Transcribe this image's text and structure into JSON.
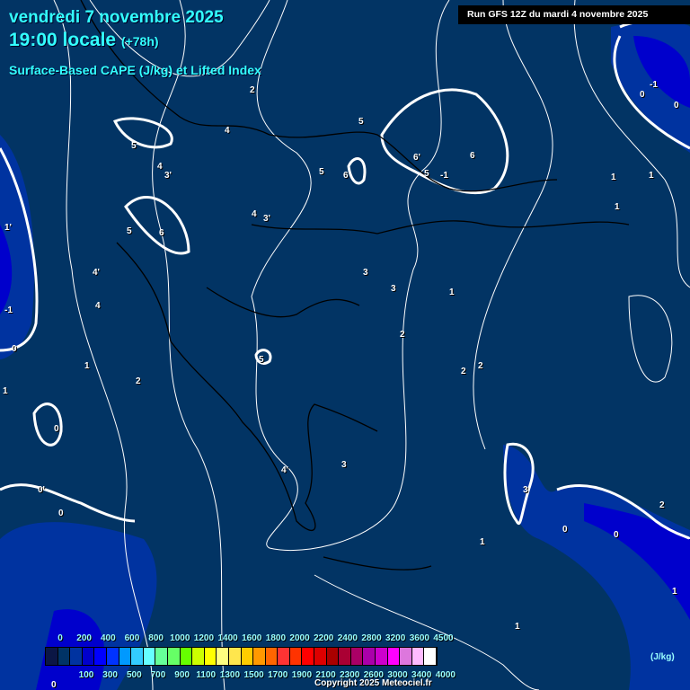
{
  "header": {
    "date": "vendredi 7 novembre 2025",
    "time": "19:00 locale",
    "offset": "(+78h)",
    "parameter": "Surface-Based CAPE (J/kg) et Lifted Index",
    "run": "Run GFS 12Z du mardi 4 novembre 2025"
  },
  "legend": {
    "colors": [
      "#0b1645",
      "#003366",
      "#0033a0",
      "#0000cc",
      "#0000ff",
      "#0033ff",
      "#0099ff",
      "#33ccff",
      "#66ffff",
      "#66ff99",
      "#66ff66",
      "#66ff00",
      "#ccff00",
      "#ffff00",
      "#ffff80",
      "#ffe64d",
      "#ffcc00",
      "#ff9900",
      "#ff6600",
      "#ff3333",
      "#ff3300",
      "#ff0000",
      "#dd0000",
      "#aa0000",
      "#aa0033",
      "#aa0066",
      "#aa00aa",
      "#cc00cc",
      "#ff00ff",
      "#dd77dd",
      "#ffbbff",
      "#ffffff"
    ],
    "top_labels": [
      "0",
      "200",
      "400",
      "600",
      "800",
      "1000",
      "1200",
      "1400",
      "1600",
      "1800",
      "2000",
      "2200",
      "2400",
      "2800",
      "3200",
      "3600",
      "4500"
    ],
    "bottom_labels": [
      "100",
      "300",
      "500",
      "700",
      "900",
      "1100",
      "1300",
      "1500",
      "1700",
      "1900",
      "2100",
      "2300",
      "2600",
      "3000",
      "3400",
      "4000"
    ],
    "unit": "(J/kg)"
  },
  "copyright": "Copyright 2025 Meteociel.fr",
  "contour_labels": [
    "2",
    "4",
    "5",
    "4",
    "3'",
    "5",
    "6",
    "4",
    "3'",
    "4'",
    "4",
    "1",
    "2",
    "0",
    "0'",
    "0",
    "1'",
    "-1",
    "0",
    "1",
    "5",
    "5",
    "6",
    "6'",
    "5",
    "6",
    "1",
    "1",
    "1",
    "3",
    "3",
    "2",
    "1",
    "2",
    "2",
    "5",
    "3",
    "4'",
    "3",
    "0",
    "1",
    "1",
    "0",
    "0",
    "1",
    "-1",
    "0",
    "-1",
    "2",
    "0"
  ]
}
